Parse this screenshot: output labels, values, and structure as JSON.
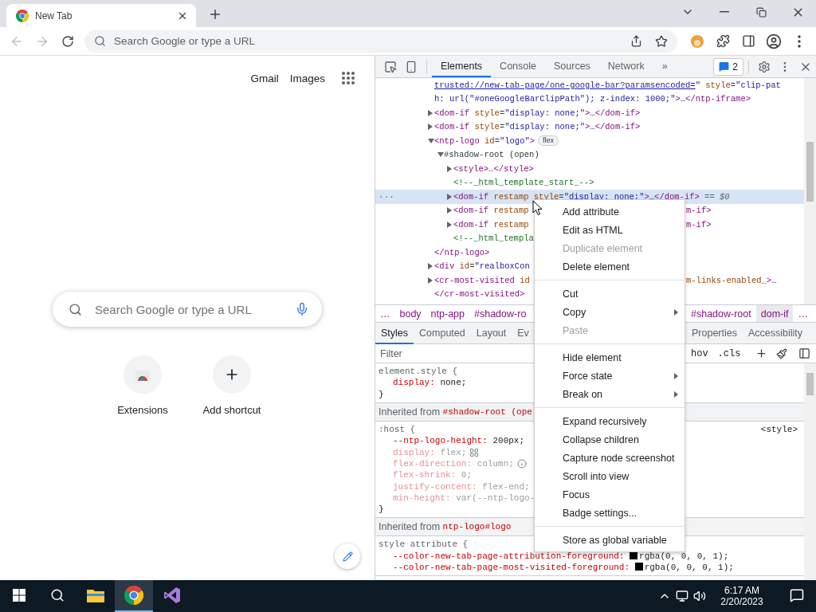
{
  "browser": {
    "tab": {
      "title": "New Tab"
    },
    "omnibox": {
      "placeholder": "Search Google or type a URL"
    },
    "back_disabled": true,
    "forward_disabled": true
  },
  "page": {
    "links": [
      "Gmail",
      "Images"
    ],
    "search": {
      "placeholder": "Search Google or type a URL"
    },
    "shortcuts": [
      {
        "label": "Extensions",
        "kind": "store"
      },
      {
        "label": "Add shortcut",
        "kind": "add"
      }
    ]
  },
  "devtools": {
    "tabs": [
      {
        "label": "Elements",
        "selected": true
      },
      {
        "label": "Console",
        "selected": false
      },
      {
        "label": "Sources",
        "selected": false
      },
      {
        "label": "Network",
        "selected": false
      },
      {
        "label": "»",
        "selected": false
      }
    ],
    "issues": "2",
    "tree": [
      {
        "kind": "leaf",
        "selected": false,
        "tokens": [
          {
            "kind": "link",
            "text": "trusted://new-tab-page/one-google-bar?paramsencoded="
          },
          {
            "kind": "val",
            "text": "\""
          },
          {
            "kind": "attr",
            "text": " style"
          },
          {
            "kind": "plain",
            "text": "="
          },
          {
            "kind": "val",
            "text": "\"clip-pat"
          }
        ]
      },
      {
        "kind": "leaf",
        "selected": false,
        "tokens": [
          {
            "kind": "val",
            "text": "h: url(\"#oneGoogleBarClipPath\"); z-index: 1000;\""
          },
          {
            "kind": "tag",
            "text": ">"
          },
          {
            "kind": "plain",
            "text": "…"
          },
          {
            "kind": "tag",
            "text": "</ntp-iframe>"
          }
        ]
      },
      {
        "kind": "collapsed",
        "selected": false,
        "tokens": [
          {
            "kind": "tag",
            "text": "<dom-if"
          },
          {
            "kind": "attr",
            "text": " style"
          },
          {
            "kind": "plain",
            "text": "="
          },
          {
            "kind": "val",
            "text": "\"display: none;\""
          },
          {
            "kind": "tag",
            "text": ">"
          },
          {
            "kind": "plain",
            "text": "…"
          },
          {
            "kind": "tag",
            "text": "</dom-if>"
          }
        ]
      },
      {
        "kind": "collapsed",
        "selected": false,
        "tokens": [
          {
            "kind": "tag",
            "text": "<dom-if"
          },
          {
            "kind": "attr",
            "text": " style"
          },
          {
            "kind": "plain",
            "text": "="
          },
          {
            "kind": "val",
            "text": "\"display: none;\""
          },
          {
            "kind": "tag",
            "text": ">"
          },
          {
            "kind": "plain",
            "text": "…"
          },
          {
            "kind": "tag",
            "text": "</dom-if>"
          }
        ]
      },
      {
        "kind": "expanded",
        "selected": false,
        "tokens": [
          {
            "kind": "tag",
            "text": "<ntp-logo"
          },
          {
            "kind": "attr",
            "text": " id"
          },
          {
            "kind": "plain",
            "text": "="
          },
          {
            "kind": "val",
            "text": "\"logo\""
          },
          {
            "kind": "tag",
            "text": ">"
          }
        ],
        "badge": "flex",
        "children": [
          {
            "kind": "expanded",
            "selected": false,
            "tokens": [
              {
                "kind": "plain",
                "text": "#shadow-root (open)"
              }
            ],
            "children": [
              {
                "kind": "collapsed",
                "selected": false,
                "tokens": [
                  {
                    "kind": "tag",
                    "text": "<style>"
                  },
                  {
                    "kind": "plain",
                    "text": "…"
                  },
                  {
                    "kind": "tag",
                    "text": "</style>"
                  }
                ]
              },
              {
                "kind": "leaf",
                "selected": false,
                "tokens": [
                  {
                    "kind": "comment",
                    "text": "<!--_html_template_start_-->"
                  }
                ]
              },
              {
                "kind": "collapsed",
                "selected": true,
                "dots": "···",
                "tokens": [
                  {
                    "kind": "tag",
                    "text": "<dom-if"
                  },
                  {
                    "kind": "attr",
                    "text": " restamp style"
                  },
                  {
                    "kind": "plain",
                    "text": "="
                  },
                  {
                    "kind": "val",
                    "text": "\"display: none;\""
                  },
                  {
                    "kind": "tag",
                    "text": ">"
                  },
                  {
                    "kind": "plain",
                    "text": "…"
                  },
                  {
                    "kind": "tag",
                    "text": "</dom-if>"
                  },
                  {
                    "kind": "ref",
                    "text": " == $0"
                  }
                ]
              },
              {
                "kind": "collapsed",
                "selected": false,
                "tokens": [
                  {
                    "kind": "tag",
                    "text": "<dom-if"
                  },
                  {
                    "kind": "attr",
                    "text": " restamp"
                  }
                ],
                "right": [
                  {
                    "kind": "tag",
                    "text": "m-if>"
                  }
                ]
              },
              {
                "kind": "collapsed",
                "selected": false,
                "tokens": [
                  {
                    "kind": "tag",
                    "text": "<dom-if"
                  },
                  {
                    "kind": "attr",
                    "text": " restamp"
                  }
                ],
                "right": [
                  {
                    "kind": "tag",
                    "text": "m-if>"
                  }
                ]
              },
              {
                "kind": "leaf",
                "selected": false,
                "tokens": [
                  {
                    "kind": "comment",
                    "text": "<!--_html_templa"
                  }
                ]
              }
            ]
          }
        ]
      },
      {
        "kind": "leaf",
        "selected": false,
        "tokens": [
          {
            "kind": "tag",
            "text": "</ntp-logo>"
          }
        ]
      },
      {
        "kind": "collapsed",
        "selected": false,
        "tokens": [
          {
            "kind": "tag",
            "text": "<div"
          },
          {
            "kind": "attr",
            "text": " id"
          },
          {
            "kind": "plain",
            "text": "="
          },
          {
            "kind": "val",
            "text": "\"realboxCon"
          }
        ]
      },
      {
        "kind": "collapsed",
        "selected": false,
        "tokens": [
          {
            "kind": "tag",
            "text": "<cr-most-visited"
          },
          {
            "kind": "attr",
            "text": " id"
          }
        ],
        "right": [
          {
            "kind": "attr",
            "text": "m-links-enabled_"
          },
          {
            "kind": "tag",
            "text": ">"
          },
          {
            "kind": "plain",
            "text": "…"
          }
        ]
      },
      {
        "kind": "leaf",
        "selected": false,
        "tokens": [
          {
            "kind": "tag",
            "text": "</cr-most-visited>"
          }
        ]
      }
    ],
    "breadcrumbs": {
      "left": [
        {
          "label": "…",
          "selected": false
        },
        {
          "label": "body",
          "selected": false
        },
        {
          "label": "ntp-app",
          "selected": false
        },
        {
          "label": "#shadow-ro",
          "selected": false
        }
      ],
      "right": [
        {
          "label": "#shadow-root",
          "selected": false
        },
        {
          "label": "dom-if",
          "selected": true
        },
        {
          "label": "…",
          "selected": false
        }
      ]
    },
    "subtabs": {
      "left": [
        {
          "label": "Styles",
          "selected": true
        },
        {
          "label": "Computed",
          "selected": false
        },
        {
          "label": "Layout",
          "selected": false
        },
        {
          "label": "Ev",
          "selected": false
        }
      ],
      "right": [
        {
          "label": "Properties",
          "selected": false
        },
        {
          "label": "Accessibility",
          "selected": false
        }
      ]
    },
    "filter": {
      "placeholder": "Filter",
      "buttons": [
        "hov",
        ".cls"
      ]
    },
    "styles": [
      {
        "kind": "rule",
        "selector": "element.style {",
        "props": [
          {
            "name": "display:",
            "value": "none;",
            "inactive": false
          }
        ],
        "end": "}"
      },
      {
        "kind": "inherited",
        "label": "Inherited from",
        "source": "#shadow-root (ope"
      },
      {
        "kind": "rule",
        "selector": ":host {",
        "origin": "<style>",
        "props": [
          {
            "name": "--ntp-logo-height:",
            "value": "200px;",
            "inactive": false
          },
          {
            "name": "display:",
            "value": "flex;",
            "inactive": true,
            "editor": true
          },
          {
            "name": "flex-direction:",
            "value": "column;",
            "inactive": true,
            "hint": true
          },
          {
            "name": "flex-shrink:",
            "value": "0;",
            "inactive": true
          },
          {
            "name": "justify-content:",
            "value": "flex-end;",
            "inactive": true
          },
          {
            "name": "min-height:",
            "value": "var(--ntp-logo-",
            "inactive": true
          }
        ],
        "end": "}"
      },
      {
        "kind": "inherited",
        "label": "Inherited from",
        "source": "ntp-logo#logo"
      },
      {
        "kind": "rule",
        "selector": "style attribute {",
        "props": [
          {
            "name": "--color-new-tab-page-attribution-foreground:",
            "value": "rgba(0, 0, 0, 1);",
            "inactive": false,
            "color": "#000000"
          },
          {
            "name": "--color-new-tab-page-most-visited-foreground:",
            "value": "rgba(0, 0, 0, 1);",
            "inactive": false,
            "color": "#000000"
          }
        ]
      }
    ]
  },
  "context_menu": {
    "groups": [
      [
        {
          "label": "Add attribute",
          "disabled": false,
          "submenu": false
        },
        {
          "label": "Edit as HTML",
          "disabled": false,
          "submenu": false
        },
        {
          "label": "Duplicate element",
          "disabled": true,
          "submenu": false
        },
        {
          "label": "Delete element",
          "disabled": false,
          "submenu": false
        }
      ],
      [
        {
          "label": "Cut",
          "disabled": false,
          "submenu": false
        },
        {
          "label": "Copy",
          "disabled": false,
          "submenu": true
        },
        {
          "label": "Paste",
          "disabled": true,
          "submenu": false
        }
      ],
      [
        {
          "label": "Hide element",
          "disabled": false,
          "submenu": false
        },
        {
          "label": "Force state",
          "disabled": false,
          "submenu": true
        },
        {
          "label": "Break on",
          "disabled": false,
          "submenu": true
        }
      ],
      [
        {
          "label": "Expand recursively",
          "disabled": false,
          "submenu": false
        },
        {
          "label": "Collapse children",
          "disabled": false,
          "submenu": false
        },
        {
          "label": "Capture node screenshot",
          "disabled": false,
          "submenu": false
        },
        {
          "label": "Scroll into view",
          "disabled": false,
          "submenu": false
        },
        {
          "label": "Focus",
          "disabled": false,
          "submenu": false
        },
        {
          "label": "Badge settings...",
          "disabled": false,
          "submenu": false
        }
      ],
      [
        {
          "label": "Store as global variable",
          "disabled": false,
          "submenu": false
        }
      ]
    ]
  },
  "taskbar": {
    "apps": [
      {
        "kind": "explorer",
        "active": false
      },
      {
        "kind": "chrome",
        "active": true
      },
      {
        "kind": "studio",
        "active": false
      }
    ],
    "time": "6:17 AM",
    "date": "2/20/2023"
  }
}
